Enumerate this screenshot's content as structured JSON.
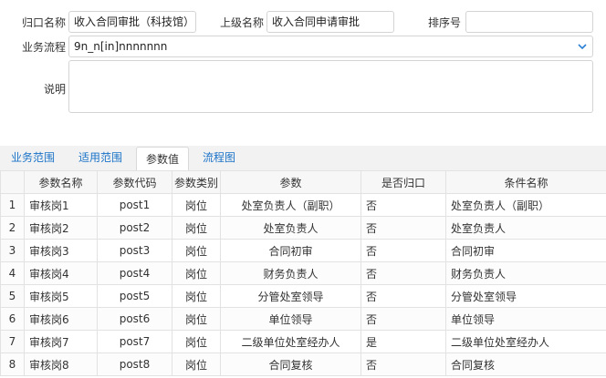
{
  "form": {
    "name_label": "归口名称",
    "name_value": "收入合同审批（科技馆）",
    "parent_label": "上级名称",
    "parent_value": "收入合同申请审批",
    "order_label": "排序号",
    "order_value": "",
    "flow_label": "业务流程",
    "flow_value": "9n_n[in]nnnnnnn",
    "desc_label": "说明",
    "desc_value": ""
  },
  "tabs": [
    {
      "label": "业务范围",
      "active": false
    },
    {
      "label": "适用范围",
      "active": false
    },
    {
      "label": "参数值",
      "active": true
    },
    {
      "label": "流程图",
      "active": false
    }
  ],
  "table": {
    "headers": [
      "",
      "参数名称",
      "参数代码",
      "参数类别",
      "参数",
      "是否归口",
      "条件名称"
    ],
    "rows": [
      [
        "1",
        "审核岗1",
        "post1",
        "岗位",
        "处室负责人（副职）",
        "否",
        "处室负责人（副职）"
      ],
      [
        "2",
        "审核岗2",
        "post2",
        "岗位",
        "处室负责人",
        "否",
        "处室负责人"
      ],
      [
        "3",
        "审核岗3",
        "post3",
        "岗位",
        "合同初审",
        "否",
        "合同初审"
      ],
      [
        "4",
        "审核岗4",
        "post4",
        "岗位",
        "财务负责人",
        "否",
        "财务负责人"
      ],
      [
        "5",
        "审核岗5",
        "post5",
        "岗位",
        "分管处室领导",
        "否",
        "分管处室领导"
      ],
      [
        "6",
        "审核岗6",
        "post6",
        "岗位",
        "单位领导",
        "否",
        "单位领导"
      ],
      [
        "7",
        "审核岗7",
        "post7",
        "岗位",
        "二级单位处室经办人",
        "是",
        "二级单位处室经办人"
      ],
      [
        "8",
        "审核岗8",
        "post8",
        "岗位",
        "合同复核",
        "否",
        "合同复核"
      ]
    ]
  },
  "colors": {
    "accent": "#1a73c8",
    "tab_bar": "#f2f2f2",
    "border": "#e2e2e2"
  }
}
